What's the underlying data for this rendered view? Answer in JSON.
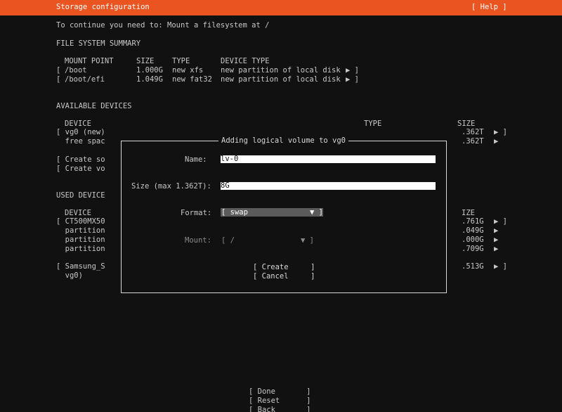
{
  "header": {
    "title": "Storage configuration",
    "help": "[ Help ]"
  },
  "instruction": "To continue you need to: Mount a filesystem at /",
  "fs_summary": {
    "heading": "FILE SYSTEM SUMMARY",
    "columns": [
      "MOUNT POINT",
      "SIZE",
      "TYPE",
      "DEVICE TYPE"
    ],
    "rows": [
      {
        "bracket": "[",
        "mount": "/boot",
        "size": "1.000G",
        "type": "new xfs",
        "device_type": "new partition of local disk",
        "arrow": "▶ ]"
      },
      {
        "bracket": "[",
        "mount": "/boot/efi",
        "size": "1.049G",
        "type": "new fat32",
        "device_type": "new partition of local disk",
        "arrow": "▶ ]"
      }
    ]
  },
  "available_devices": {
    "heading": "AVAILABLE DEVICES",
    "columns": {
      "device": "DEVICE",
      "type": "TYPE",
      "size": "SIZE"
    },
    "rows": [
      {
        "left": "[ vg0 (new)",
        "size": ".362T",
        "arrow": "▶ ]"
      },
      {
        "left": "  free spac",
        "size": ".362T",
        "arrow": "▶"
      }
    ],
    "actions": [
      "[ Create so",
      "[ Create vo"
    ]
  },
  "used_devices": {
    "heading": "USED DEVICE",
    "columns": {
      "device": "DEVICE",
      "size": "IZE"
    },
    "rows": [
      {
        "left": "[ CT500MX50",
        "size": ".761G",
        "arrow": "▶ ]"
      },
      {
        "left": "  partition",
        "size": ".049G",
        "arrow": "▶"
      },
      {
        "left": "  partition",
        "size": ".000G",
        "arrow": "▶"
      },
      {
        "left": "  partition",
        "size": ".709G",
        "arrow": "▶"
      },
      {
        "left": "[ Samsung_S",
        "size": ".513G",
        "arrow": "▶ ]"
      },
      {
        "left": "  vg0)",
        "size": "",
        "arrow": ""
      }
    ]
  },
  "dialog": {
    "title": "Adding logical volume to vg0",
    "name_label": "Name:",
    "name_value": "lv-0",
    "size_label": "Size (max 1.362T):",
    "size_value": "8G",
    "format_label": "Format:",
    "format_value": "[ swap",
    "format_arrow": "▼ ]",
    "mount_label": "Mount:",
    "mount_value": "[ /",
    "mount_arrow": "▼ ]",
    "create_button": "[ Create     ]",
    "cancel_button": "[ Cancel     ]"
  },
  "footer": {
    "done": "[ Done       ]",
    "reset": "[ Reset      ]",
    "back": "[ Back       ]"
  },
  "colors": {
    "accent": "#e95420",
    "background": "#111111",
    "text": "#c8c8c8"
  }
}
